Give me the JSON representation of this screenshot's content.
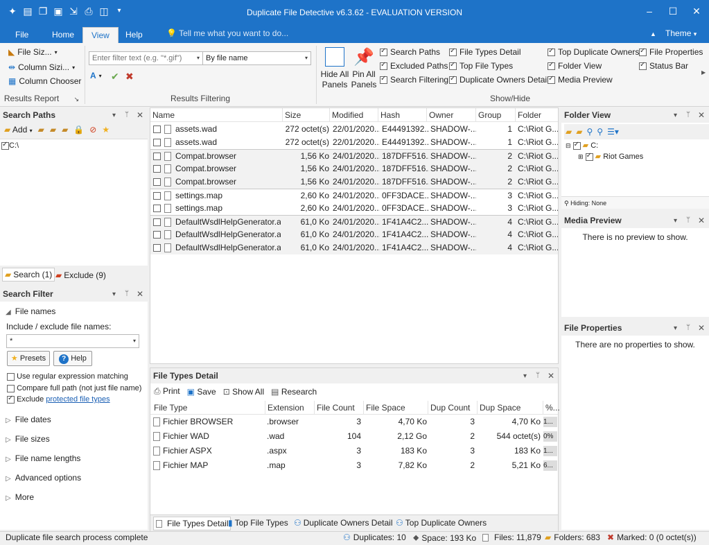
{
  "window": {
    "title": "Duplicate File Detective v6.3.62 - EVALUATION VERSION"
  },
  "menu": {
    "tabs": [
      "File",
      "Home",
      "View",
      "Help"
    ],
    "tell_me": "Tell me what you want to do...",
    "theme": "Theme"
  },
  "ribbon": {
    "results_report": {
      "items": [
        "File Siz...",
        "Column Sizi...",
        "Column Chooser"
      ],
      "label": "Results Report"
    },
    "filtering": {
      "placeholder": "Enter filter text (e.g. \"*.gif\")",
      "mode": "By file name",
      "label": "Results Filtering"
    },
    "panels": {
      "hide_all": "Hide All Panels",
      "pin_all": "Pin All Panels"
    },
    "show_hide": {
      "label": "Show/Hide",
      "items": [
        {
          "text": "Search Paths",
          "checked": true
        },
        {
          "text": "Excluded Paths",
          "checked": true
        },
        {
          "text": "Search Filtering",
          "checked": true
        },
        {
          "text": "File Types Detail",
          "checked": true
        },
        {
          "text": "Top File Types",
          "checked": true
        },
        {
          "text": "Duplicate Owners Detail",
          "checked": true
        },
        {
          "text": "Top Duplicate Owners",
          "checked": true
        },
        {
          "text": "Folder View",
          "checked": true
        },
        {
          "text": "Media Preview",
          "checked": true
        },
        {
          "text": "File Properties",
          "checked": true
        },
        {
          "text": "Status Bar",
          "checked": true
        }
      ]
    }
  },
  "search_paths": {
    "title": "Search Paths",
    "add": "Add",
    "paths": [
      "C:\\"
    ],
    "tabs": [
      "Search (1)",
      "Exclude (9)"
    ]
  },
  "search_filter": {
    "title": "Search Filter",
    "section": "File names",
    "include_label": "Include / exclude file names:",
    "include_value": "*",
    "presets": "Presets",
    "help": "Help",
    "options": [
      {
        "text": "Use regular expression matching",
        "checked": false
      },
      {
        "text": "Compare full path (not just file name)",
        "checked": false
      },
      {
        "text": "Exclude ",
        "link": "protected file types",
        "checked": true
      }
    ],
    "collapsed": [
      "File dates",
      "File sizes",
      "File name lengths",
      "Advanced options",
      "More"
    ]
  },
  "results": {
    "columns": [
      "Name",
      "Size",
      "Modified",
      "Hash",
      "Owner",
      "Group",
      "Folder"
    ],
    "rows": [
      [
        "assets.wad",
        "272 octet(s)",
        "22/01/2020...",
        "E44491392...",
        "SHADOW-...",
        "1",
        "C:\\Riot G..."
      ],
      [
        "assets.wad",
        "272 octet(s)",
        "22/01/2020...",
        "E44491392...",
        "SHADOW-...",
        "1",
        "C:\\Riot G..."
      ],
      [
        "Compat.browser",
        "1,56 Ko",
        "24/01/2020...",
        "187DFF516...",
        "SHADOW-...",
        "2",
        "C:\\Riot G..."
      ],
      [
        "Compat.browser",
        "1,56 Ko",
        "24/01/2020...",
        "187DFF516...",
        "SHADOW-...",
        "2",
        "C:\\Riot G..."
      ],
      [
        "Compat.browser",
        "1,56 Ko",
        "24/01/2020...",
        "187DFF516...",
        "SHADOW-...",
        "2",
        "C:\\Riot G..."
      ],
      [
        "settings.map",
        "2,60 Ko",
        "24/01/2020...",
        "0FF3DACE...",
        "SHADOW-...",
        "3",
        "C:\\Riot G..."
      ],
      [
        "settings.map",
        "2,60 Ko",
        "24/01/2020...",
        "0FF3DACE...",
        "SHADOW-...",
        "3",
        "C:\\Riot G..."
      ],
      [
        "DefaultWsdlHelpGenerator.a...",
        "61,0 Ko",
        "24/01/2020...",
        "1F41A4C2...",
        "SHADOW-...",
        "4",
        "C:\\Riot G..."
      ],
      [
        "DefaultWsdlHelpGenerator.a...",
        "61,0 Ko",
        "24/01/2020...",
        "1F41A4C2...",
        "SHADOW-...",
        "4",
        "C:\\Riot G..."
      ],
      [
        "DefaultWsdlHelpGenerator.a...",
        "61,0 Ko",
        "24/01/2020...",
        "1F41A4C2...",
        "SHADOW-...",
        "4",
        "C:\\Riot G..."
      ]
    ]
  },
  "file_types_detail": {
    "title": "File Types Detail",
    "toolbar": [
      "Print",
      "Save",
      "Show All",
      "Research"
    ],
    "columns": [
      "File Type",
      "Extension",
      "File Count",
      "File Space",
      "Dup Count",
      "Dup Space",
      "%..."
    ],
    "rows": [
      [
        "Fichier BROWSER",
        ".browser",
        "3",
        "4,70 Ko",
        "3",
        "4,70 Ko",
        "1..."
      ],
      [
        "Fichier WAD",
        ".wad",
        "104",
        "2,12 Go",
        "2",
        "544 octet(s)",
        "0%"
      ],
      [
        "Fichier ASPX",
        ".aspx",
        "3",
        "183 Ko",
        "3",
        "183 Ko",
        "1..."
      ],
      [
        "Fichier MAP",
        ".map",
        "3",
        "7,82 Ko",
        "2",
        "5,21 Ko",
        "6..."
      ]
    ],
    "tabs": [
      "File Types Detail",
      "Top File Types",
      "Duplicate Owners Detail",
      "Top Duplicate Owners"
    ]
  },
  "folder_view": {
    "title": "Folder View",
    "tree": [
      "C:",
      "Riot Games"
    ],
    "hiding": "Hiding: None"
  },
  "media_preview": {
    "title": "Media Preview",
    "empty": "There is no preview to show."
  },
  "file_properties": {
    "title": "File Properties",
    "empty": "There are no properties to show."
  },
  "statusbar": {
    "message": "Duplicate file search process complete",
    "duplicates": "Duplicates: 10",
    "space": "Space: 193 Ko",
    "files": "Files: 11,879",
    "folders": "Folders: 683",
    "marked": "Marked: 0 (0 octet(s))"
  },
  "colors": {
    "accent": "#1e73c8",
    "group_alt": "#f2f2f2"
  }
}
